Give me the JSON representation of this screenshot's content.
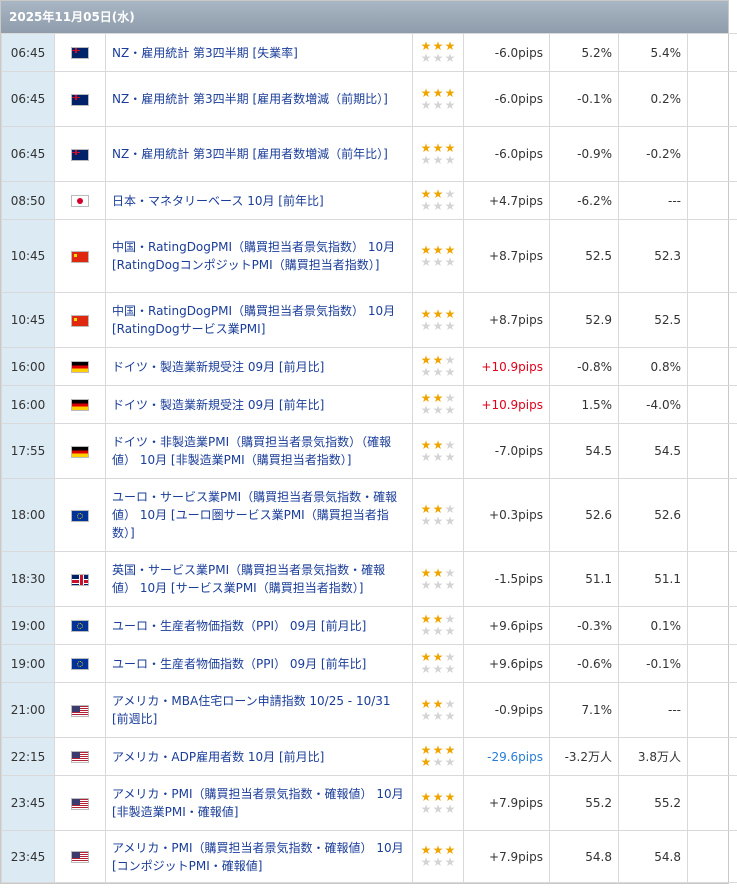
{
  "date_header": "2025年11月05日(水)",
  "colors": {
    "pips_red": "#e2001a",
    "pips_blue": "#2a7dd6",
    "title_link": "#1a3d99",
    "star_on": "#f0a400",
    "star_off": "#d4d4d4"
  },
  "rows": [
    {
      "time": "06:45",
      "country": "nz",
      "flag_icon": "nz-flag-icon",
      "title": "NZ・雇用統計 第3四半期 [失業率]",
      "stars": 3,
      "pips": "-6.0pips",
      "pips_color": "neg",
      "actual": "5.2%",
      "forecast": "5.4%",
      "previous": "---"
    },
    {
      "time": "06:45",
      "country": "nz",
      "flag_icon": "nz-flag-icon",
      "title": "NZ・雇用統計 第3四半期 [雇用者数増減（前期比）]",
      "stars": 3,
      "pips": "-6.0pips",
      "pips_color": "neg",
      "actual": "-0.1%",
      "forecast": "0.2%",
      "previous": "---"
    },
    {
      "time": "06:45",
      "country": "nz",
      "flag_icon": "nz-flag-icon",
      "title": "NZ・雇用統計 第3四半期 [雇用者数増減（前年比）]",
      "stars": 3,
      "pips": "-6.0pips",
      "pips_color": "neg",
      "actual": "-0.9%",
      "forecast": "-0.2%",
      "previous": "---"
    },
    {
      "time": "08:50",
      "country": "jp",
      "flag_icon": "japan-flag-icon",
      "title": "日本・マネタリーベース 10月 [前年比]",
      "stars": 2,
      "pips": "+4.7pips",
      "pips_color": "neg",
      "actual": "-6.2%",
      "forecast": "---",
      "previous": "---"
    },
    {
      "time": "10:45",
      "country": "cn",
      "flag_icon": "china-flag-icon",
      "title": "中国・RatingDogPMI（購買担当者景気指数） 10月 [RatingDogコンポジットPMI（購買担当者指数）]",
      "stars": 3,
      "pips": "+8.7pips",
      "pips_color": "neg",
      "actual": "52.5",
      "forecast": "52.3",
      "previous": "---"
    },
    {
      "time": "10:45",
      "country": "cn",
      "flag_icon": "china-flag-icon",
      "title": "中国・RatingDogPMI（購買担当者景気指数） 10月 [RatingDogサービス業PMI]",
      "stars": 3,
      "pips": "+8.7pips",
      "pips_color": "neg",
      "actual": "52.9",
      "forecast": "52.5",
      "previous": "---"
    },
    {
      "time": "16:00",
      "country": "de",
      "flag_icon": "germany-flag-icon",
      "title": "ドイツ・製造業新規受注 09月 [前月比]",
      "stars": 2,
      "pips": "+10.9pips",
      "pips_color": "red",
      "actual": "-0.8%",
      "forecast": "0.8%",
      "previous": "---"
    },
    {
      "time": "16:00",
      "country": "de",
      "flag_icon": "germany-flag-icon",
      "title": "ドイツ・製造業新規受注 09月 [前年比]",
      "stars": 2,
      "pips": "+10.9pips",
      "pips_color": "red",
      "actual": "1.5%",
      "forecast": "-4.0%",
      "previous": "---"
    },
    {
      "time": "17:55",
      "country": "de",
      "flag_icon": "germany-flag-icon",
      "title": "ドイツ・非製造業PMI（購買担当者景気指数）（確報値） 10月 [非製造業PMI（購買担当者指数）]",
      "stars": 2,
      "pips": "-7.0pips",
      "pips_color": "neg",
      "actual": "54.5",
      "forecast": "54.5",
      "previous": "---"
    },
    {
      "time": "18:00",
      "country": "eu",
      "flag_icon": "eu-flag-icon",
      "title": "ユーロ・サービス業PMI（購買担当者景気指数・確報値） 10月 [ユーロ圏サービス業PMI（購買担当者指数）]",
      "stars": 2,
      "pips": "+0.3pips",
      "pips_color": "neg",
      "actual": "52.6",
      "forecast": "52.6",
      "previous": "---"
    },
    {
      "time": "18:30",
      "country": "uk",
      "flag_icon": "uk-flag-icon",
      "title": "英国・サービス業PMI（購買担当者景気指数・確報値） 10月 [サービス業PMI（購買担当者指数）]",
      "stars": 2,
      "pips": "-1.5pips",
      "pips_color": "neg",
      "actual": "51.1",
      "forecast": "51.1",
      "previous": "---"
    },
    {
      "time": "19:00",
      "country": "eu",
      "flag_icon": "eu-flag-icon",
      "title": "ユーロ・生産者物価指数（PPI） 09月 [前月比]",
      "stars": 2,
      "pips": "+9.6pips",
      "pips_color": "neg",
      "actual": "-0.3%",
      "forecast": "0.1%",
      "previous": "---"
    },
    {
      "time": "19:00",
      "country": "eu",
      "flag_icon": "eu-flag-icon",
      "title": "ユーロ・生産者物価指数（PPI） 09月 [前年比]",
      "stars": 2,
      "pips": "+9.6pips",
      "pips_color": "neg",
      "actual": "-0.6%",
      "forecast": "-0.1%",
      "previous": "---"
    },
    {
      "time": "21:00",
      "country": "us",
      "flag_icon": "us-flag-icon",
      "title": "アメリカ・MBA住宅ローン申請指数 10/25 - 10/31 [前週比]",
      "stars": 2,
      "pips": "-0.9pips",
      "pips_color": "neg",
      "actual": "7.1%",
      "forecast": "---",
      "previous": "---"
    },
    {
      "time": "22:15",
      "country": "us",
      "flag_icon": "us-flag-icon",
      "title": "アメリカ・ADP雇用者数 10月 [前月比]",
      "stars": 4,
      "pips": "-29.6pips",
      "pips_color": "blue",
      "actual": "-3.2万人",
      "forecast": "3.8万人",
      "previous": "---"
    },
    {
      "time": "23:45",
      "country": "us",
      "flag_icon": "us-flag-icon",
      "title": "アメリカ・PMI（購買担当者景気指数・確報値） 10月 [非製造業PMI・確報値]",
      "stars": 3,
      "pips": "+7.9pips",
      "pips_color": "neg",
      "actual": "55.2",
      "forecast": "55.2",
      "previous": "---"
    },
    {
      "time": "23:45",
      "country": "us",
      "flag_icon": "us-flag-icon",
      "title": "アメリカ・PMI（購買担当者景気指数・確報値） 10月 [コンポジットPMI・確報値]",
      "stars": 3,
      "pips": "+7.9pips",
      "pips_color": "neg",
      "actual": "54.8",
      "forecast": "54.8",
      "previous": "---"
    }
  ]
}
